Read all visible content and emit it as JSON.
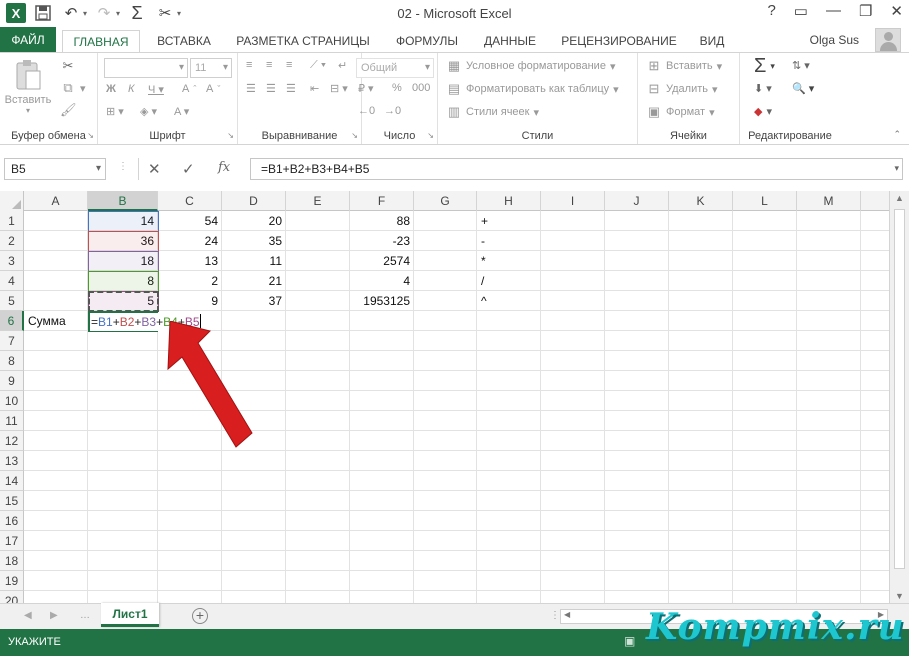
{
  "window": {
    "title": "02 - Microsoft Excel",
    "help": "?",
    "controls": [
      "🗗",
      "—",
      "🗗",
      "✕"
    ]
  },
  "ribbon_tabs": [
    "ФАЙЛ",
    "ГЛАВНАЯ",
    "ВСТАВКА",
    "РАЗМЕТКА СТРАНИЦЫ",
    "ФОРМУЛЫ",
    "ДАННЫЕ",
    "РЕЦЕНЗИРОВАНИЕ",
    "ВИД"
  ],
  "active_tab": "ГЛАВНАЯ",
  "user": {
    "name": "Olga Sus"
  },
  "ribbon": {
    "clipboard": {
      "label": "Буфер обмена",
      "paste": "Вставить"
    },
    "font": {
      "label": "Шрифт",
      "size": "11"
    },
    "alignment": {
      "label": "Выравнивание"
    },
    "number": {
      "label": "Число",
      "format": "Общий"
    },
    "styles": {
      "label": "Стили",
      "cond_format": "Условное форматирование",
      "format_table": "Форматировать как таблицу",
      "cell_styles": "Стили ячеек"
    },
    "cells": {
      "label": "Ячейки",
      "insert": "Вставить",
      "delete": "Удалить",
      "format": "Формат"
    },
    "editing": {
      "label": "Редактирование"
    }
  },
  "formula_bar": {
    "name_box": "B5",
    "formula": "=B1+B2+B3+B4+B5",
    "fx": "fx"
  },
  "columns": [
    "A",
    "B",
    "C",
    "D",
    "E",
    "F",
    "G",
    "H",
    "I",
    "J",
    "K",
    "L",
    "M"
  ],
  "rows": [
    "1",
    "2",
    "3",
    "4",
    "5",
    "6",
    "7",
    "8",
    "9",
    "10",
    "11",
    "12",
    "13",
    "14",
    "15",
    "16",
    "17",
    "18",
    "19",
    "20"
  ],
  "cells": {
    "A6": "Сумма",
    "B1": "14",
    "B2": "36",
    "B3": "18",
    "B4": "8",
    "B5": "5",
    "C1": "54",
    "C2": "24",
    "C3": "13",
    "C4": "2",
    "C5": "9",
    "D1": "20",
    "D2": "35",
    "D3": "11",
    "D4": "21",
    "D5": "37",
    "F1": "88",
    "F2": "-23",
    "F3": "2574",
    "F4": "4",
    "F5": "1953125",
    "H1": "+",
    "H2": "-",
    "H3": "*",
    "H4": "/",
    "H5": "^"
  },
  "edit_formula": {
    "eq": "=",
    "parts": [
      {
        "ref": "B1",
        "color": "#4472c4"
      },
      {
        "sep": "+"
      },
      {
        "ref": "B2",
        "color": "#c0504d"
      },
      {
        "sep": "+"
      },
      {
        "ref": "B3",
        "color": "#8064a2"
      },
      {
        "sep": "+"
      },
      {
        "ref": "B4",
        "color": "#4c9a2a"
      },
      {
        "sep": "+"
      },
      {
        "ref": "B5",
        "color": "#a0488c"
      }
    ]
  },
  "sheet_tabs": [
    "Лист1"
  ],
  "status": {
    "mode": "УКАЖИТЕ"
  },
  "watermark": "Kompmix.ru",
  "colors": {
    "excel_green": "#217346",
    "arrow_red": "#d81e1e"
  }
}
